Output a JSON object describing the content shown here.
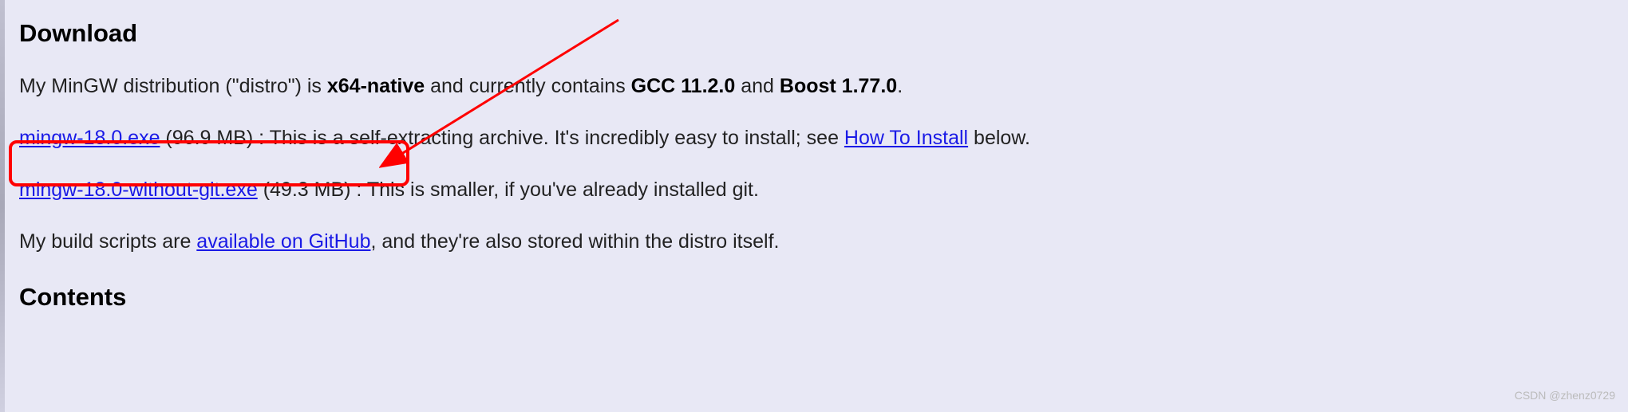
{
  "heading_download": "Download",
  "intro": {
    "prefix": "My MinGW distribution (\"distro\") is ",
    "native": "x64-native",
    "mid1": " and currently contains ",
    "gcc": "GCC 11.2.0",
    "mid2": " and ",
    "boost": "Boost 1.77.0",
    "suffix": "."
  },
  "line1": {
    "link_text": "mingw-18.0.exe",
    "size": " (96.9 MB) : ",
    "desc": "This is a self-extracting archive. It's incredibly easy to install; see ",
    "howto_link": "How To Install",
    "after": " below."
  },
  "line2": {
    "link_text": "mingw-18.0-without-git.exe",
    "size": " (49.3 MB) : ",
    "desc": "This is smaller, if you've already installed git."
  },
  "line3": {
    "prefix": "My build scripts are ",
    "link_text": "available on GitHub",
    "suffix": ", and they're also stored within the distro itself."
  },
  "heading_contents": "Contents",
  "watermark": "CSDN @zhenz0729"
}
